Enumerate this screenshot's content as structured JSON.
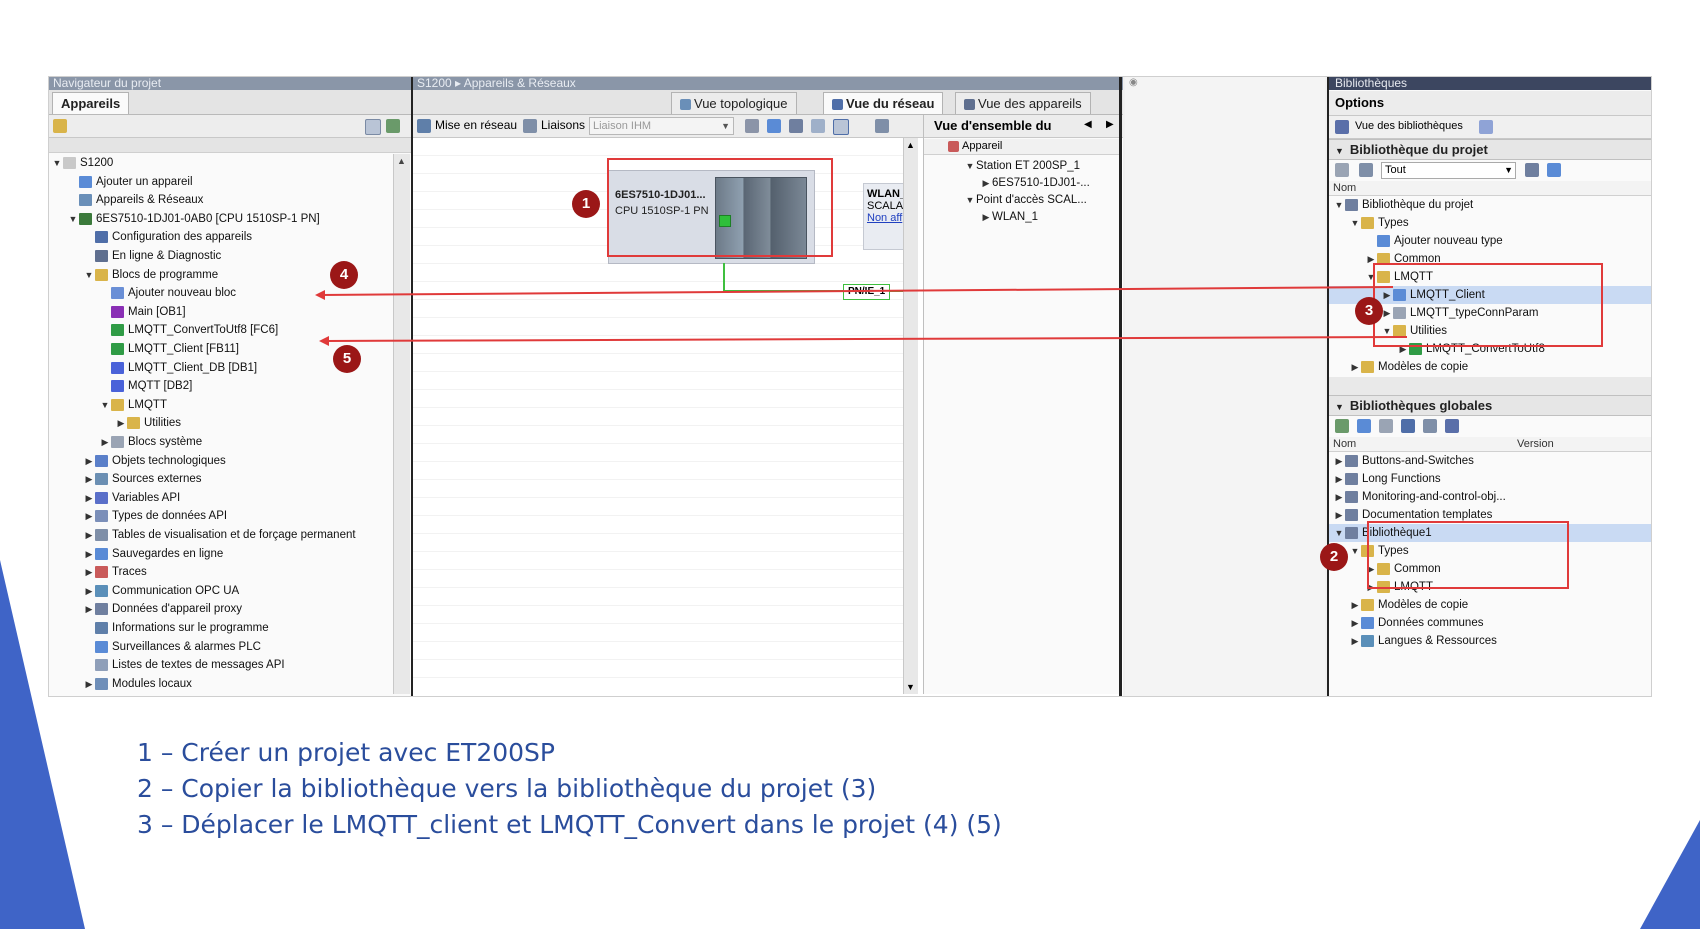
{
  "left_panel": {
    "title": "Navigateur du projet",
    "tab": "Appareils",
    "tree": [
      {
        "label": "S1200",
        "indent": 0,
        "tw": "▼",
        "icon": "#c9c9c9"
      },
      {
        "label": "Ajouter un appareil",
        "indent": 1,
        "tw": "",
        "icon": "#5a8bd6"
      },
      {
        "label": "Appareils & Réseaux",
        "indent": 1,
        "tw": "",
        "icon": "#6a8fb8"
      },
      {
        "label": "6ES7510-1DJ01-0AB0 [CPU 1510SP-1 PN]",
        "indent": 1,
        "tw": "▼",
        "icon": "#3b7a3b"
      },
      {
        "label": "Configuration des appareils",
        "indent": 2,
        "tw": "",
        "icon": "#4f6ea8"
      },
      {
        "label": "En ligne & Diagnostic",
        "indent": 2,
        "tw": "",
        "icon": "#5f6f8f"
      },
      {
        "label": "Blocs de programme",
        "indent": 2,
        "tw": "▼",
        "icon": "#d9b44a"
      },
      {
        "label": "Ajouter nouveau bloc",
        "indent": 3,
        "tw": "",
        "icon": "#6a8fd6"
      },
      {
        "label": "Main [OB1]",
        "indent": 3,
        "tw": "",
        "icon": "#8a2fb5"
      },
      {
        "label": "LMQTT_ConvertToUtf8 [FC6]",
        "indent": 3,
        "tw": "",
        "icon": "#2f9b45"
      },
      {
        "label": "LMQTT_Client [FB11]",
        "indent": 3,
        "tw": "",
        "icon": "#2f9b45"
      },
      {
        "label": "LMQTT_Client_DB [DB1]",
        "indent": 3,
        "tw": "",
        "icon": "#4a62d9"
      },
      {
        "label": "MQTT [DB2]",
        "indent": 3,
        "tw": "",
        "icon": "#4a62d9"
      },
      {
        "label": "LMQTT",
        "indent": 3,
        "tw": "▼",
        "icon": "#d9b44a"
      },
      {
        "label": "Utilities",
        "indent": 4,
        "tw": "▶",
        "icon": "#d9b44a"
      },
      {
        "label": "Blocs système",
        "indent": 3,
        "tw": "▶",
        "icon": "#9aa4b4"
      },
      {
        "label": "Objets technologiques",
        "indent": 2,
        "tw": "▶",
        "icon": "#5a7fc9"
      },
      {
        "label": "Sources externes",
        "indent": 2,
        "tw": "▶",
        "icon": "#6b8fb3"
      },
      {
        "label": "Variables API",
        "indent": 2,
        "tw": "▶",
        "icon": "#5a6fc9"
      },
      {
        "label": "Types de données API",
        "indent": 2,
        "tw": "▶",
        "icon": "#7b8fb9"
      },
      {
        "label": "Tables de visualisation et de forçage permanent",
        "indent": 2,
        "tw": "▶",
        "icon": "#7f8fa8"
      },
      {
        "label": "Sauvegardes en ligne",
        "indent": 2,
        "tw": "▶",
        "icon": "#5a8bd6"
      },
      {
        "label": "Traces",
        "indent": 2,
        "tw": "▶",
        "icon": "#c95a5a"
      },
      {
        "label": "Communication OPC UA",
        "indent": 2,
        "tw": "▶",
        "icon": "#5a8fb9"
      },
      {
        "label": "Données d'appareil proxy",
        "indent": 2,
        "tw": "▶",
        "icon": "#6f7f9f"
      },
      {
        "label": "Informations sur le programme",
        "indent": 2,
        "tw": "",
        "icon": "#5f7fa9"
      },
      {
        "label": "Surveillances & alarmes PLC",
        "indent": 2,
        "tw": "",
        "icon": "#5a8bd6"
      },
      {
        "label": "Listes de textes de messages API",
        "indent": 2,
        "tw": "",
        "icon": "#8f9fb9"
      },
      {
        "label": "Modules locaux",
        "indent": 2,
        "tw": "▶",
        "icon": "#6f8fb9"
      }
    ]
  },
  "center_panel": {
    "breadcrumb": "S1200 ▸ Appareils & Réseaux",
    "tabs": [
      "Vue topologique",
      "Vue du réseau",
      "Vue des appareils"
    ],
    "toolbar": {
      "network": "Mise en réseau",
      "links": "Liaisons",
      "dropdown": "Liaison IHM"
    },
    "device": {
      "name": "6ES7510-1DJ01...",
      "cpu": "CPU 1510SP-1 PN"
    },
    "wlan": {
      "name": "WLAN_",
      "sub": "SCALAN",
      "link": "Non aff"
    },
    "network_label": "PN/IE_1"
  },
  "overview": {
    "title": "Vue d'ensemble du",
    "col": "Appareil",
    "rows": [
      "Station ET 200SP_1",
      "6ES7510-1DJ01-...",
      "Point d'accès SCAL...",
      "WLAN_1"
    ]
  },
  "right_panel": {
    "title": "Bibliothèques",
    "options": "Options",
    "lib_view": "Vue des bibliothèques",
    "project_lib_header": "Bibliothèque du projet",
    "filter": "Tout",
    "col_name": "Nom",
    "project_tree": [
      {
        "label": "Bibliothèque du projet",
        "indent": 0,
        "tw": "▼",
        "icon": "#6f7f9f"
      },
      {
        "label": "Types",
        "indent": 1,
        "tw": "▼",
        "icon": "#d9b44a"
      },
      {
        "label": "Ajouter nouveau type",
        "indent": 2,
        "tw": "",
        "icon": "#5a8bd6"
      },
      {
        "label": "Common",
        "indent": 2,
        "tw": "▶",
        "icon": "#d9b44a"
      },
      {
        "label": "LMQTT",
        "indent": 2,
        "tw": "▼",
        "icon": "#d9b44a"
      },
      {
        "label": "LMQTT_Client",
        "indent": 3,
        "tw": "▶",
        "icon": "#5a8bd6",
        "sel": true
      },
      {
        "label": "LMQTT_typeConnParam",
        "indent": 3,
        "tw": "▶",
        "icon": "#9aa4b4"
      },
      {
        "label": "Utilities",
        "indent": 3,
        "tw": "▼",
        "icon": "#d9b44a"
      },
      {
        "label": "LMQTT_ConvertToUtf8",
        "indent": 4,
        "tw": "▶",
        "icon": "#2f9b45"
      },
      {
        "label": "Modèles de copie",
        "indent": 1,
        "tw": "▶",
        "icon": "#d9b44a"
      }
    ],
    "global_lib_header": "Bibliothèques globales",
    "col_version": "Version",
    "global_tree": [
      {
        "label": "Buttons-and-Switches",
        "indent": 0,
        "tw": "▶",
        "icon": "#6f7f9f"
      },
      {
        "label": "Long Functions",
        "indent": 0,
        "tw": "▶",
        "icon": "#6f7f9f"
      },
      {
        "label": "Monitoring-and-control-obj...",
        "indent": 0,
        "tw": "▶",
        "icon": "#6f7f9f"
      },
      {
        "label": "Documentation templates",
        "indent": 0,
        "tw": "▶",
        "icon": "#6f7f9f"
      },
      {
        "label": "Bibliothèque1",
        "indent": 0,
        "tw": "▼",
        "icon": "#6f7f9f",
        "sel": true
      },
      {
        "label": "Types",
        "indent": 1,
        "tw": "▼",
        "icon": "#d9b44a"
      },
      {
        "label": "Common",
        "indent": 2,
        "tw": "▶",
        "icon": "#d9b44a"
      },
      {
        "label": "LMQTT",
        "indent": 2,
        "tw": "▶",
        "icon": "#d9b44a"
      },
      {
        "label": "Modèles de copie",
        "indent": 1,
        "tw": "▶",
        "icon": "#d9b44a"
      },
      {
        "label": "Données communes",
        "indent": 1,
        "tw": "▶",
        "icon": "#5a8bd6"
      },
      {
        "label": "Langues & Ressources",
        "indent": 1,
        "tw": "▶",
        "icon": "#5a8fb9"
      }
    ]
  },
  "badges": [
    "1",
    "2",
    "3",
    "4",
    "5"
  ],
  "captions": [
    "1 – Créer un projet avec ET200SP",
    "2 – Copier la bibliothèque vers la bibliothèque du projet (3)",
    "3 – Déplacer le LMQTT_client et LMQTT_Convert dans le projet (4) (5)"
  ],
  "colors": {
    "accent": "#2a4d9c",
    "badge": "#9b1717",
    "highlight": "#e03a3a",
    "triangle": "#3f64c7"
  }
}
